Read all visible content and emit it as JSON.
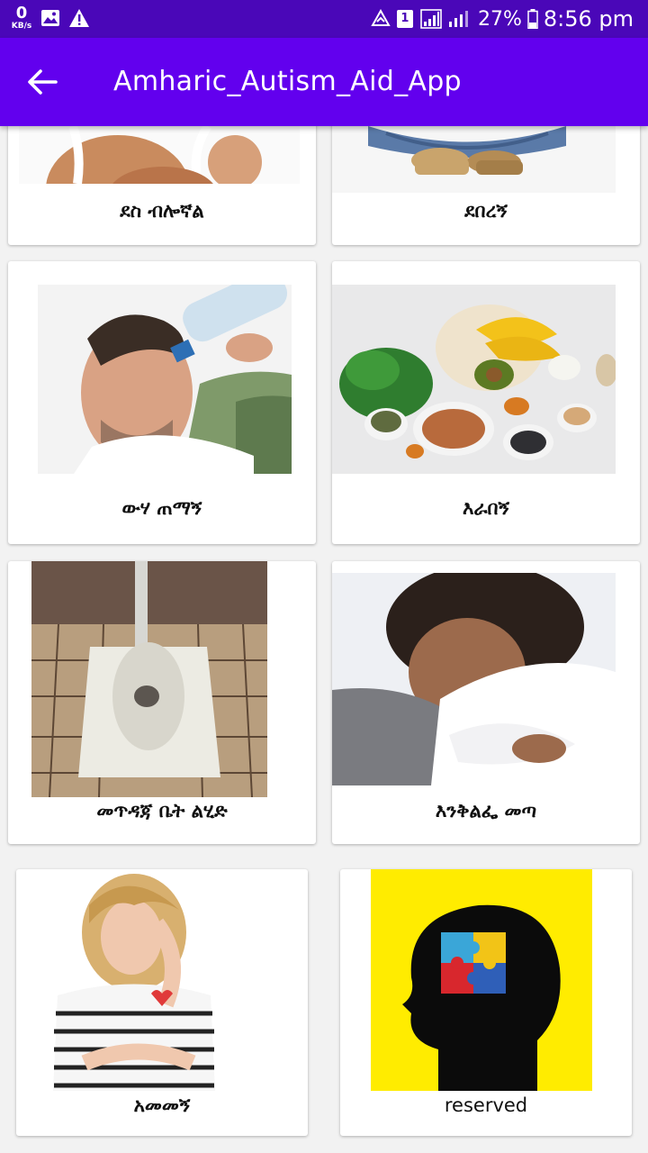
{
  "status_bar": {
    "kbs_value": "0",
    "kbs_unit": "KB/s",
    "sim_slot": "1",
    "battery_percent": "27%",
    "time": "8:56 pm"
  },
  "app_bar": {
    "title": "Amharic_Autism_Aid_App"
  },
  "cards": [
    {
      "label": "ደስ ብሎኛል",
      "image": "smiling-woman"
    },
    {
      "label": "ደበረኝ",
      "image": "sitting-person"
    },
    {
      "label": "ውሃ ጠማኝ",
      "image": "man-drinking-water"
    },
    {
      "label": "እራበኝ",
      "image": "healthy-food"
    },
    {
      "label": "መጥዳጃ ቤት ልሂድ",
      "image": "squat-toilet"
    },
    {
      "label": "እንቅልፌ መጣ",
      "image": "sleeping-child"
    },
    {
      "label": "አመመኝ",
      "image": "woman-headache"
    },
    {
      "label": "reserved",
      "image": "puzzle-head"
    }
  ]
}
